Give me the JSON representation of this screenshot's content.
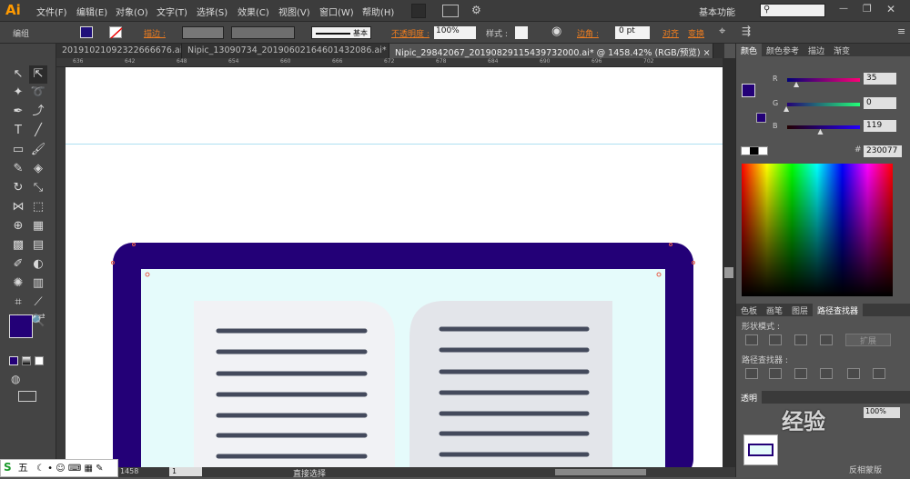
{
  "app": {
    "logo": "Ai",
    "workspace": "基本功能"
  },
  "menu": [
    "文件(F)",
    "编辑(E)",
    "对象(O)",
    "文字(T)",
    "选择(S)",
    "效果(C)",
    "视图(V)",
    "窗口(W)",
    "帮助(H)"
  ],
  "control": {
    "selection": "编组",
    "stroke_label": "描边 :",
    "brush": "基本",
    "opacity_label": "不透明度 :",
    "opacity": "100%",
    "style_label": "样式 :",
    "corner_label": "边角 :",
    "corner_value": "0 pt",
    "align": "对齐",
    "transform": "变换",
    "fill_color": "#20107a"
  },
  "tabs": [
    {
      "label": "20191021092322666676.ai*",
      "close": "×",
      "active": false
    },
    {
      "label": "Nipic_13090734_20190602164601432086.ai*",
      "close": "×",
      "active": false
    },
    {
      "label": "Nipic_29842067_20190829115439732000.ai* @ 1458.42% (RGB/预览)",
      "close": "×",
      "active": true
    }
  ],
  "ruler": [
    "636",
    "642",
    "648",
    "654",
    "660",
    "666",
    "672",
    "678",
    "684",
    "690",
    "696",
    "702"
  ],
  "color_panel": {
    "tabs": [
      "颜色",
      "颜色参考",
      "描边",
      "渐变"
    ],
    "r_label": "R",
    "g_label": "G",
    "b_label": "B",
    "r": "35",
    "g": "0",
    "b": "119",
    "r_fraction": 0.137,
    "g_fraction": 0.0,
    "b_fraction": 0.467,
    "hex": "230077",
    "hash": "#",
    "swatch": "#230077"
  },
  "lower_panel": {
    "tabs": [
      "色板",
      "画笔",
      "图层",
      "路径查找器"
    ],
    "shape_modes": "形状模式 :",
    "expand": "扩展",
    "pathfinders": "路径查找器 :"
  },
  "transparency": {
    "label": "透明",
    "opacity": "100%",
    "invert": "反相蒙版"
  },
  "status": {
    "zoom": "1458",
    "page": "1",
    "tool": "直接选择"
  },
  "taskbar": {
    "ime": "五"
  },
  "watermark": "经验",
  "artwork": {
    "frame": "#230077",
    "screen": "#e5fbfb",
    "page_left": "#f1f2f5",
    "page_right": "#e3e5ea",
    "line": "#444a5c"
  }
}
